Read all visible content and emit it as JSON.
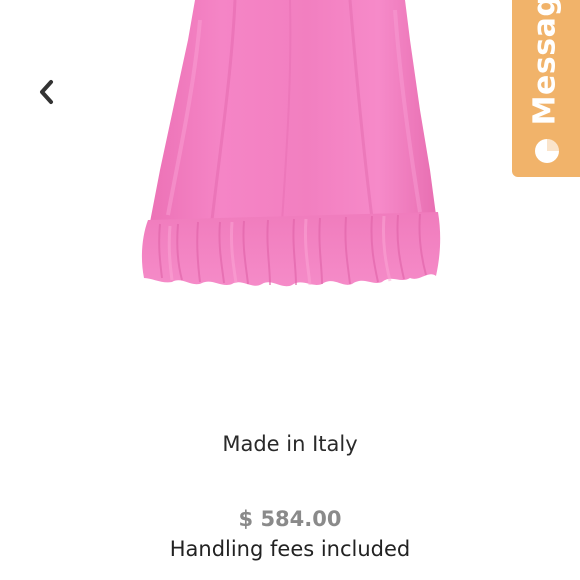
{
  "product": {
    "origin": "Made in Italy",
    "price": "$ 584.00",
    "fees_note": "Handling fees included"
  },
  "chat_tab": {
    "label": "Messag",
    "color": "#f1b36a",
    "icon": "chat-bubble-icon"
  },
  "navigation": {
    "back_icon": "chevron-left-icon"
  },
  "colors": {
    "dress": "#f27fc0",
    "price_text": "#8a8a8a"
  }
}
